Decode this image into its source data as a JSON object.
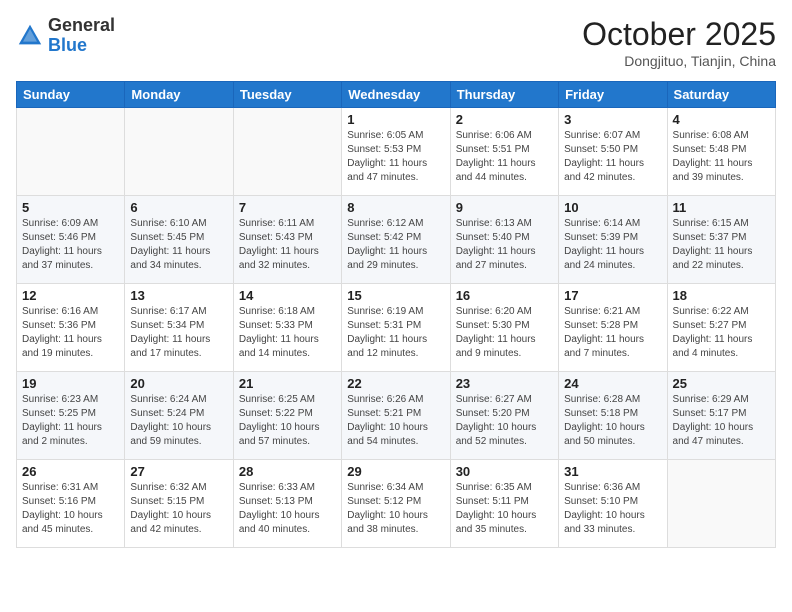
{
  "header": {
    "logo_general": "General",
    "logo_blue": "Blue",
    "month_title": "October 2025",
    "location": "Dongjituo, Tianjin, China"
  },
  "weekdays": [
    "Sunday",
    "Monday",
    "Tuesday",
    "Wednesday",
    "Thursday",
    "Friday",
    "Saturday"
  ],
  "weeks": [
    [
      {
        "day": "",
        "info": ""
      },
      {
        "day": "",
        "info": ""
      },
      {
        "day": "",
        "info": ""
      },
      {
        "day": "1",
        "info": "Sunrise: 6:05 AM\nSunset: 5:53 PM\nDaylight: 11 hours and 47 minutes."
      },
      {
        "day": "2",
        "info": "Sunrise: 6:06 AM\nSunset: 5:51 PM\nDaylight: 11 hours and 44 minutes."
      },
      {
        "day": "3",
        "info": "Sunrise: 6:07 AM\nSunset: 5:50 PM\nDaylight: 11 hours and 42 minutes."
      },
      {
        "day": "4",
        "info": "Sunrise: 6:08 AM\nSunset: 5:48 PM\nDaylight: 11 hours and 39 minutes."
      }
    ],
    [
      {
        "day": "5",
        "info": "Sunrise: 6:09 AM\nSunset: 5:46 PM\nDaylight: 11 hours and 37 minutes."
      },
      {
        "day": "6",
        "info": "Sunrise: 6:10 AM\nSunset: 5:45 PM\nDaylight: 11 hours and 34 minutes."
      },
      {
        "day": "7",
        "info": "Sunrise: 6:11 AM\nSunset: 5:43 PM\nDaylight: 11 hours and 32 minutes."
      },
      {
        "day": "8",
        "info": "Sunrise: 6:12 AM\nSunset: 5:42 PM\nDaylight: 11 hours and 29 minutes."
      },
      {
        "day": "9",
        "info": "Sunrise: 6:13 AM\nSunset: 5:40 PM\nDaylight: 11 hours and 27 minutes."
      },
      {
        "day": "10",
        "info": "Sunrise: 6:14 AM\nSunset: 5:39 PM\nDaylight: 11 hours and 24 minutes."
      },
      {
        "day": "11",
        "info": "Sunrise: 6:15 AM\nSunset: 5:37 PM\nDaylight: 11 hours and 22 minutes."
      }
    ],
    [
      {
        "day": "12",
        "info": "Sunrise: 6:16 AM\nSunset: 5:36 PM\nDaylight: 11 hours and 19 minutes."
      },
      {
        "day": "13",
        "info": "Sunrise: 6:17 AM\nSunset: 5:34 PM\nDaylight: 11 hours and 17 minutes."
      },
      {
        "day": "14",
        "info": "Sunrise: 6:18 AM\nSunset: 5:33 PM\nDaylight: 11 hours and 14 minutes."
      },
      {
        "day": "15",
        "info": "Sunrise: 6:19 AM\nSunset: 5:31 PM\nDaylight: 11 hours and 12 minutes."
      },
      {
        "day": "16",
        "info": "Sunrise: 6:20 AM\nSunset: 5:30 PM\nDaylight: 11 hours and 9 minutes."
      },
      {
        "day": "17",
        "info": "Sunrise: 6:21 AM\nSunset: 5:28 PM\nDaylight: 11 hours and 7 minutes."
      },
      {
        "day": "18",
        "info": "Sunrise: 6:22 AM\nSunset: 5:27 PM\nDaylight: 11 hours and 4 minutes."
      }
    ],
    [
      {
        "day": "19",
        "info": "Sunrise: 6:23 AM\nSunset: 5:25 PM\nDaylight: 11 hours and 2 minutes."
      },
      {
        "day": "20",
        "info": "Sunrise: 6:24 AM\nSunset: 5:24 PM\nDaylight: 10 hours and 59 minutes."
      },
      {
        "day": "21",
        "info": "Sunrise: 6:25 AM\nSunset: 5:22 PM\nDaylight: 10 hours and 57 minutes."
      },
      {
        "day": "22",
        "info": "Sunrise: 6:26 AM\nSunset: 5:21 PM\nDaylight: 10 hours and 54 minutes."
      },
      {
        "day": "23",
        "info": "Sunrise: 6:27 AM\nSunset: 5:20 PM\nDaylight: 10 hours and 52 minutes."
      },
      {
        "day": "24",
        "info": "Sunrise: 6:28 AM\nSunset: 5:18 PM\nDaylight: 10 hours and 50 minutes."
      },
      {
        "day": "25",
        "info": "Sunrise: 6:29 AM\nSunset: 5:17 PM\nDaylight: 10 hours and 47 minutes."
      }
    ],
    [
      {
        "day": "26",
        "info": "Sunrise: 6:31 AM\nSunset: 5:16 PM\nDaylight: 10 hours and 45 minutes."
      },
      {
        "day": "27",
        "info": "Sunrise: 6:32 AM\nSunset: 5:15 PM\nDaylight: 10 hours and 42 minutes."
      },
      {
        "day": "28",
        "info": "Sunrise: 6:33 AM\nSunset: 5:13 PM\nDaylight: 10 hours and 40 minutes."
      },
      {
        "day": "29",
        "info": "Sunrise: 6:34 AM\nSunset: 5:12 PM\nDaylight: 10 hours and 38 minutes."
      },
      {
        "day": "30",
        "info": "Sunrise: 6:35 AM\nSunset: 5:11 PM\nDaylight: 10 hours and 35 minutes."
      },
      {
        "day": "31",
        "info": "Sunrise: 6:36 AM\nSunset: 5:10 PM\nDaylight: 10 hours and 33 minutes."
      },
      {
        "day": "",
        "info": ""
      }
    ]
  ]
}
